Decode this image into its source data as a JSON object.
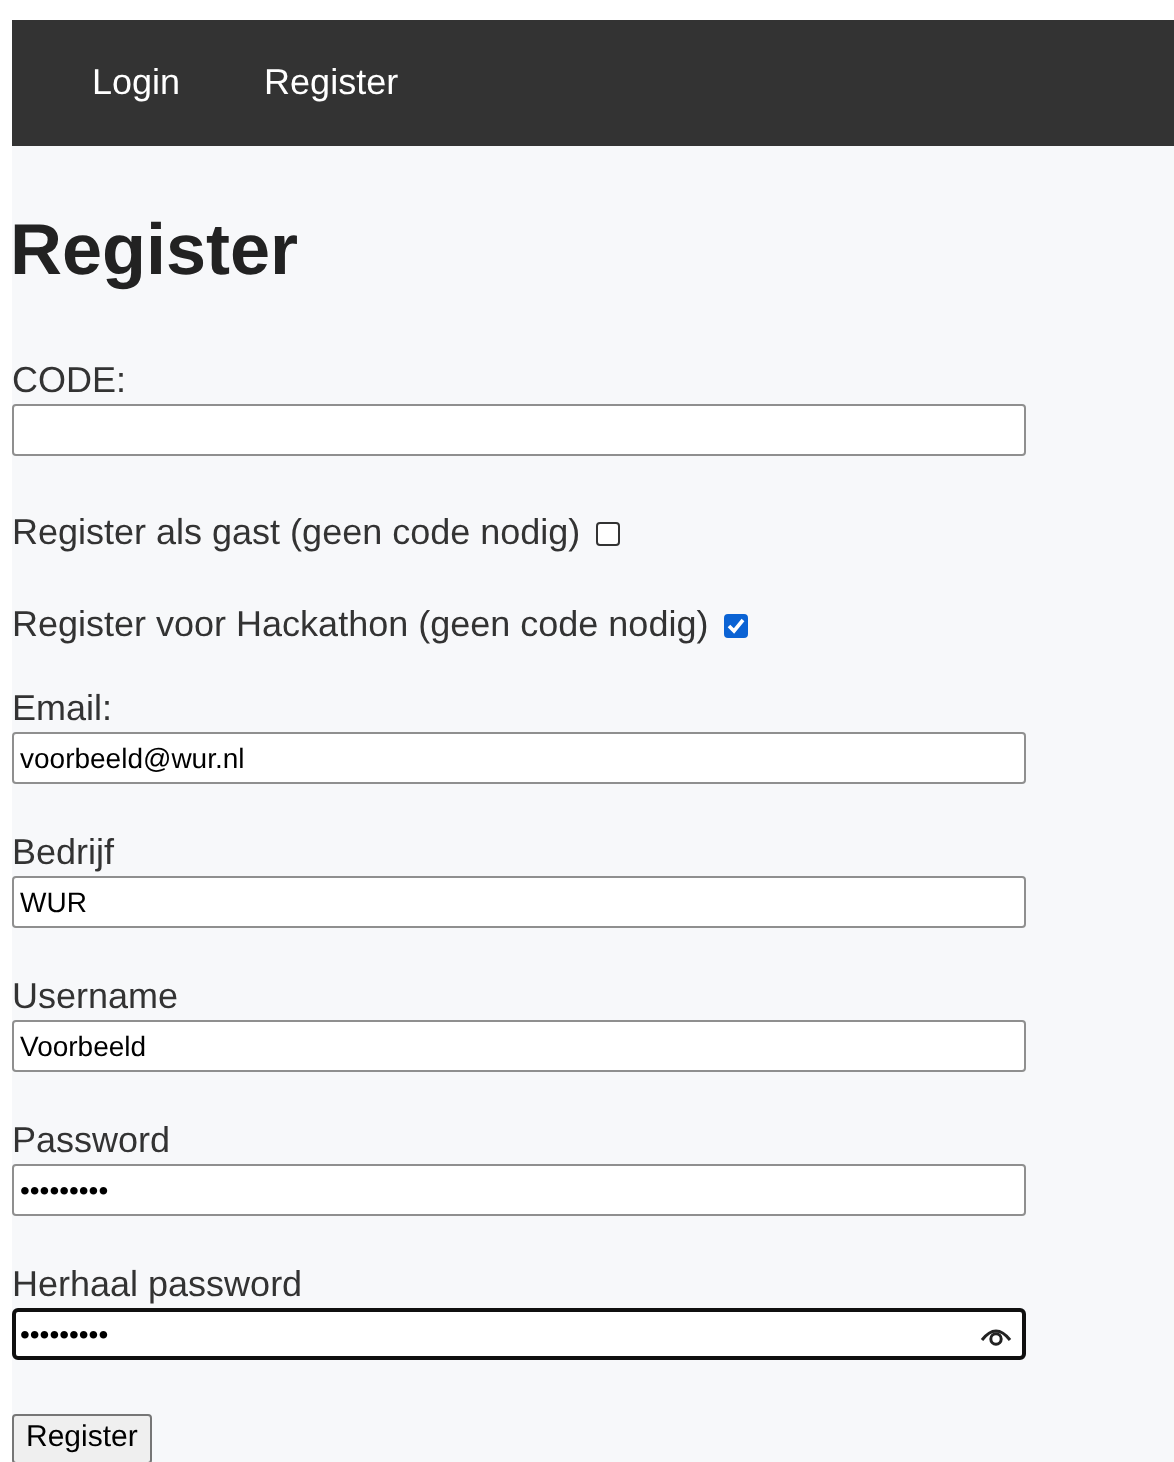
{
  "nav": {
    "items": [
      {
        "label": "Login"
      },
      {
        "label": "Register"
      }
    ]
  },
  "heading": "Register",
  "form": [
    {
      "kind": "field",
      "label": "CODE:",
      "focused": false
    },
    {
      "kind": "checkbox",
      "label": "Register als gast (geen code nodig)",
      "checked": false
    },
    {
      "kind": "checkbox",
      "label": "Register voor Hackathon (geen code nodig)",
      "checked": true
    },
    {
      "kind": "field",
      "label": "Email:",
      "value": "voorbeeld@wur.nl",
      "focused": false
    },
    {
      "kind": "field",
      "label": "Bedrijf",
      "value": "WUR",
      "focused": false
    },
    {
      "kind": "field",
      "label": "Username",
      "value": "Voorbeeld",
      "focused": false
    },
    {
      "kind": "field",
      "label": "Password",
      "value": "•••••••••",
      "focused": false
    },
    {
      "kind": "field",
      "label": "Herhaal password",
      "value": "•••••••••",
      "focused": true,
      "reveal": true
    }
  ],
  "submit": "Register"
}
